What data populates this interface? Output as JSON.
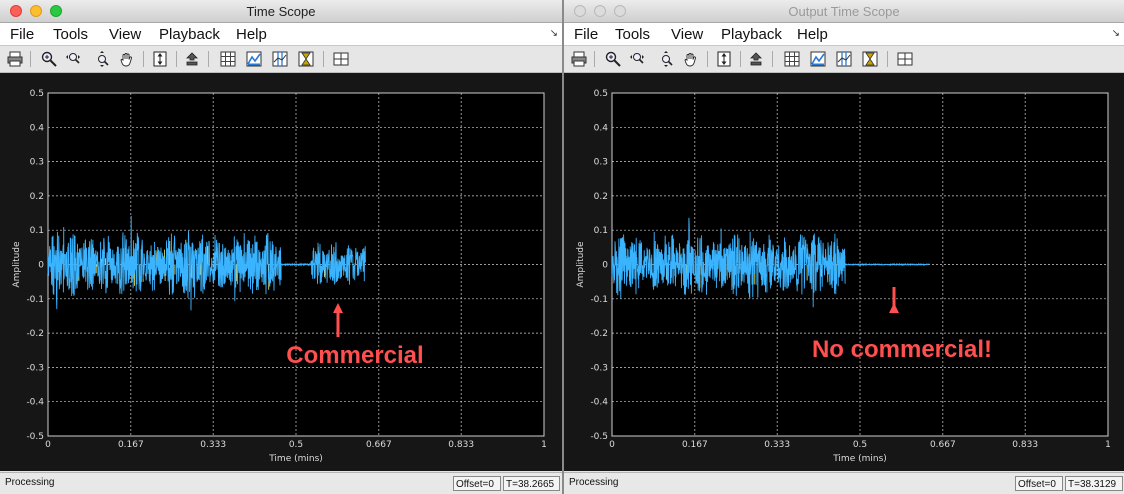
{
  "windows": [
    {
      "title": "Time Scope",
      "active": true,
      "menu": [
        "File",
        "Tools",
        "View",
        "Playback",
        "Help"
      ],
      "status": {
        "text": "Processing",
        "offset": "Offset=0",
        "time": "T=38.2665"
      },
      "annotation": "Commercial",
      "chart_data": {
        "type": "line",
        "xlabel": "Time (mins)",
        "ylabel": "Amplitude",
        "xlim": [
          0,
          1
        ],
        "ylim": [
          -0.5,
          0.5
        ],
        "grid": true,
        "x_ticks": [
          "0",
          "0.167",
          "0.333",
          "0.5",
          "0.667",
          "0.833",
          "1"
        ],
        "y_ticks": [
          "0.5",
          "0.4",
          "0.3",
          "0.2",
          "0.1",
          "0",
          "-0.1",
          "-0.2",
          "-0.3",
          "-0.4",
          "-0.5"
        ],
        "series": [
          {
            "color": "#3ab4ff",
            "segments": [
              {
                "x0": 0.0,
                "x1": 0.47,
                "amp": 0.1,
                "peak": 0.15
              },
              {
                "x0": 0.47,
                "x1": 0.53,
                "amp": 0.002
              },
              {
                "x0": 0.53,
                "x1": 0.64,
                "amp": 0.07,
                "peak": 0.08
              }
            ]
          }
        ]
      }
    },
    {
      "title": "Output Time Scope",
      "active": false,
      "menu": [
        "File",
        "Tools",
        "View",
        "Playback",
        "Help"
      ],
      "status": {
        "text": "Processing",
        "offset": "Offset=0",
        "time": "T=38.3129"
      },
      "annotation": "No commercial!",
      "chart_data": {
        "type": "line",
        "xlabel": "Time (mins)",
        "ylabel": "Amplitude",
        "xlim": [
          0,
          1
        ],
        "ylim": [
          -0.5,
          0.5
        ],
        "grid": true,
        "x_ticks": [
          "0",
          "0.167",
          "0.333",
          "0.5",
          "0.667",
          "0.833",
          "1"
        ],
        "y_ticks": [
          "0.5",
          "0.4",
          "0.3",
          "0.2",
          "0.1",
          "0",
          "-0.1",
          "-0.2",
          "-0.3",
          "-0.4",
          "-0.5"
        ],
        "series": [
          {
            "color": "#3ab4ff",
            "segments": [
              {
                "x0": 0.0,
                "x1": 0.47,
                "amp": 0.1,
                "peak": 0.15
              },
              {
                "x0": 0.47,
                "x1": 0.64,
                "amp": 0.0015
              }
            ]
          }
        ]
      }
    }
  ],
  "toolbar": {
    "icons": [
      "print-icon",
      "zoom-in-icon",
      "zoom-x-icon",
      "zoom-y-icon",
      "pan-hand-icon",
      "autoscale-icon",
      "restore-icon",
      "grid-icon",
      "legend-icon",
      "cursor-icon",
      "triggers-icon",
      "layout-icon"
    ]
  },
  "colors": {
    "background": "#161616",
    "axes": "#000000",
    "grid": "#cfcfcf",
    "signal": "#3ab4ff",
    "signal_alt": "#f2ee6e",
    "annotation": "#ff4f4f"
  }
}
